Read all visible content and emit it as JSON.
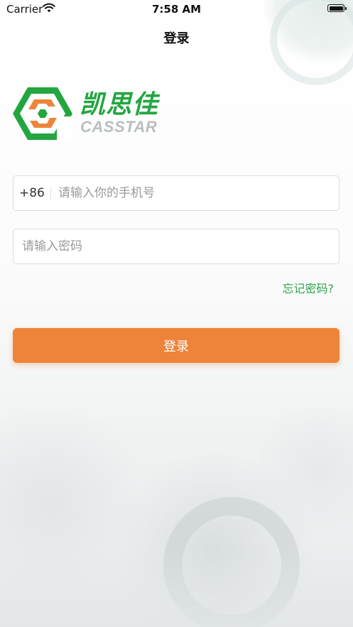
{
  "status_bar": {
    "carrier": "Carrier",
    "time": "7:58 AM"
  },
  "nav": {
    "title": "登录"
  },
  "logo": {
    "name_cn": "凯思佳",
    "name_en": "CASSTAR"
  },
  "form": {
    "phone_prefix": "+86",
    "phone_placeholder": "请输入你的手机号",
    "password_placeholder": "请输入密码",
    "forgot_link": "忘记密码?",
    "submit_label": "登录"
  },
  "colors": {
    "brand_green": "#23a640",
    "brand_orange": "#ed843a",
    "link_green": "#2fa34b",
    "logo_gray": "#b9bec1"
  },
  "icons": [
    "wifi-icon",
    "battery-icon",
    "casstar-logo-icon"
  ]
}
